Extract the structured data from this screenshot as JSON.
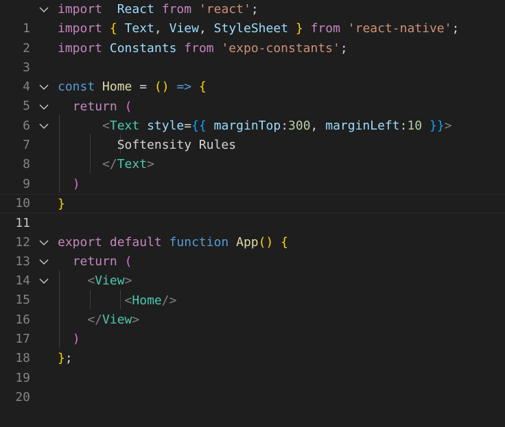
{
  "line_numbers": [
    "1",
    "2",
    "3",
    "4",
    "5",
    "6",
    "7",
    "8",
    "9",
    "10",
    "11",
    "12",
    "13",
    "14",
    "15",
    "16",
    "17",
    "18",
    "19",
    "20"
  ],
  "tokens": {
    "l1": [
      "import",
      "React",
      "from",
      "'react'",
      ";"
    ],
    "l2": [
      "import",
      "{",
      "Text",
      ",",
      "View",
      ",",
      "StyleSheet",
      "}",
      "from",
      "'react-native'",
      ";"
    ],
    "l3": [
      "import",
      "Constants",
      "from",
      "'expo-constants'",
      ";"
    ],
    "l5": [
      "const",
      "Home",
      "=",
      "()",
      "=>",
      "{"
    ],
    "l6": [
      "return",
      "("
    ],
    "l7": [
      "<",
      "Text",
      "style",
      "=",
      "{{",
      "marginTop",
      ":",
      "300",
      ",",
      "marginLeft",
      ":",
      "10",
      "}}",
      ">"
    ],
    "l8": [
      "Softensity Rules"
    ],
    "l9": [
      "</",
      "Text",
      ">"
    ],
    "l10": [
      ")"
    ],
    "l11": [
      "}"
    ],
    "l13": [
      "export",
      "default",
      "function",
      "App",
      "()",
      "{"
    ],
    "l14": [
      "return",
      "("
    ],
    "l15": [
      "<",
      "View",
      ">"
    ],
    "l16": [
      "<",
      "Home",
      "/>"
    ],
    "l17": [
      "</",
      "View",
      ">"
    ],
    "l18": [
      ")"
    ],
    "l19": [
      "}",
      ";"
    ]
  },
  "colors": {
    "background": "#1e1e1e",
    "keyword_control": "#c586c0",
    "keyword_storage": "#569cd6",
    "string": "#ce9178",
    "variable": "#9cdcfe",
    "function": "#dcdcaa",
    "jsx_tag": "#4ec9b0",
    "number": "#b5cea8",
    "bracket_level1": "#ffd700",
    "bracket_level2": "#da70d6",
    "bracket_level3": "#179fff"
  },
  "icons": {
    "fold": "chevron-down-icon"
  }
}
